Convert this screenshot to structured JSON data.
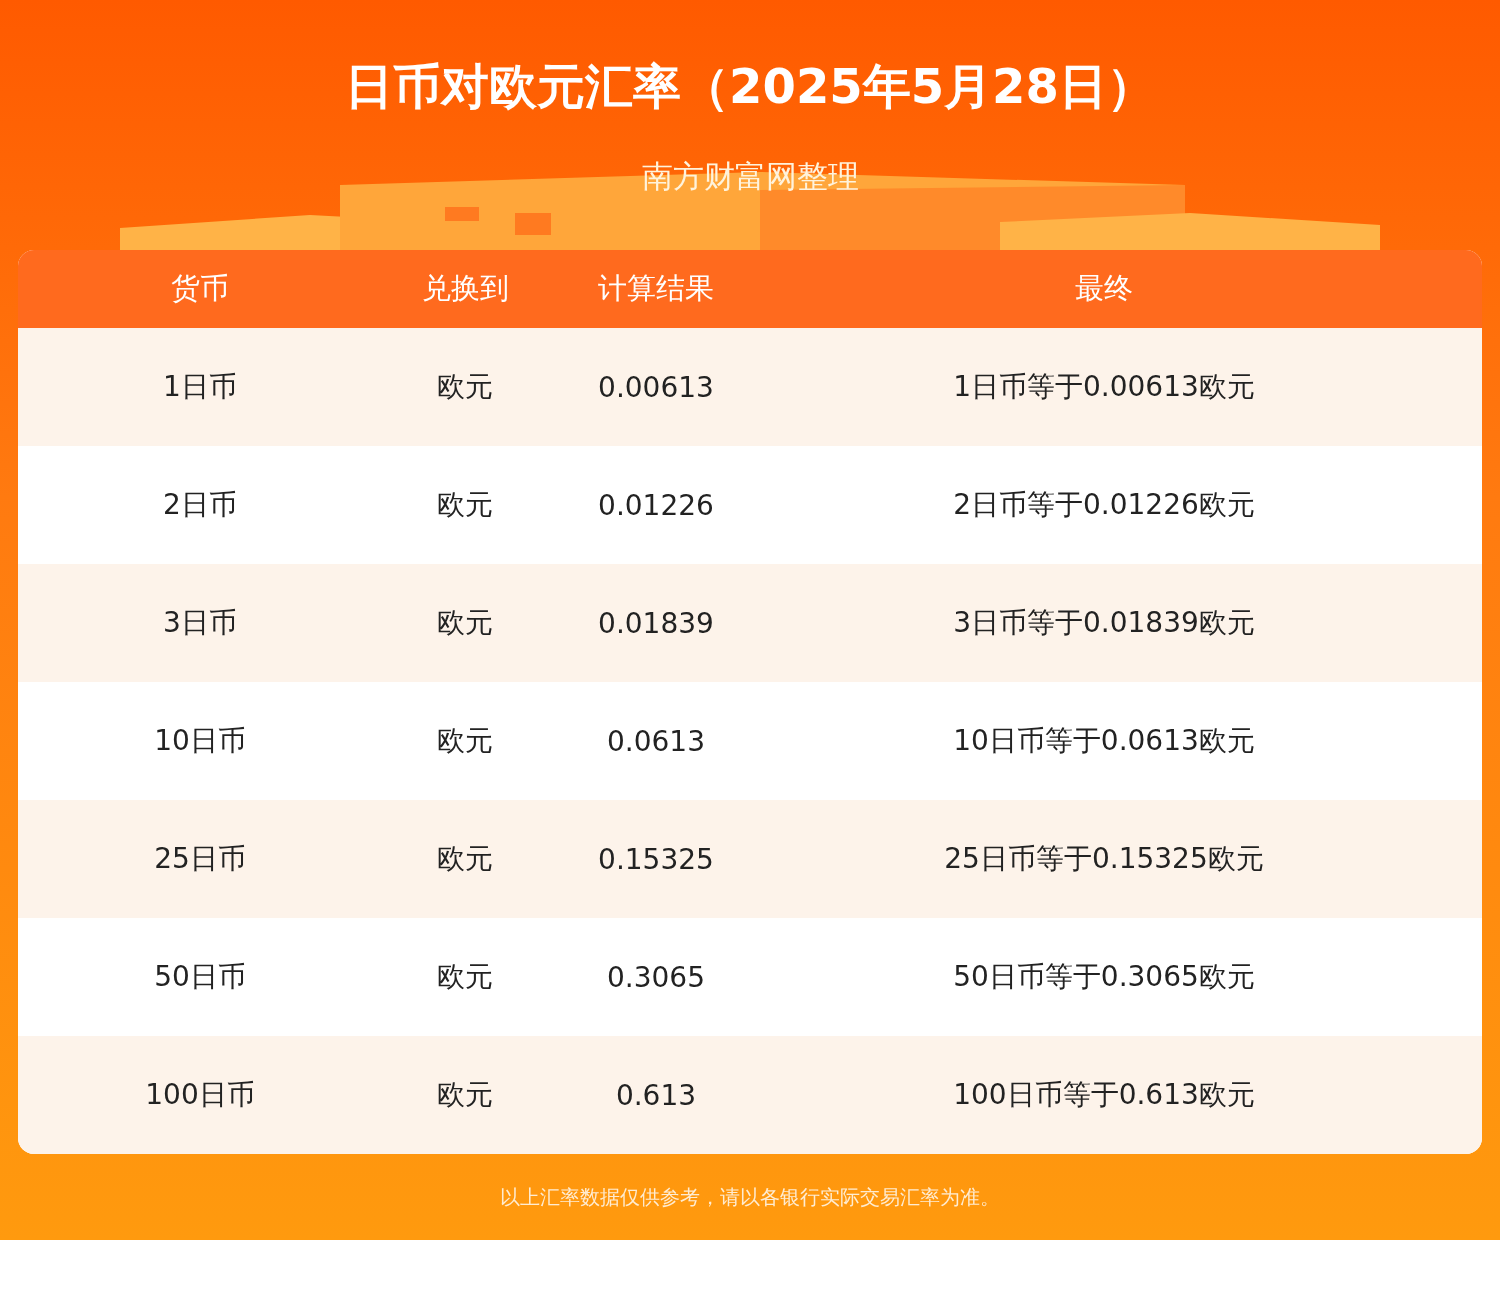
{
  "title": "日币对欧元汇率（2025年5月28日）",
  "subtitle": "南方财富网整理",
  "table": {
    "columns": [
      "货币",
      "兑换到",
      "计算结果",
      "最终"
    ],
    "rows": [
      [
        "1日币",
        "欧元",
        "0.00613",
        "1日币等于0.00613欧元"
      ],
      [
        "2日币",
        "欧元",
        "0.01226",
        "2日币等于0.01226欧元"
      ],
      [
        "3日币",
        "欧元",
        "0.01839",
        "3日币等于0.01839欧元"
      ],
      [
        "10日币",
        "欧元",
        "0.0613",
        "10日币等于0.0613欧元"
      ],
      [
        "25日币",
        "欧元",
        "0.15325",
        "25日币等于0.15325欧元"
      ],
      [
        "50日币",
        "欧元",
        "0.3065",
        "50日币等于0.3065欧元"
      ],
      [
        "100日币",
        "欧元",
        "0.613",
        "100日币等于0.613欧元"
      ]
    ]
  },
  "footer_note": "以上汇率数据仅供参考，请以各银行实际交易汇率为准。"
}
